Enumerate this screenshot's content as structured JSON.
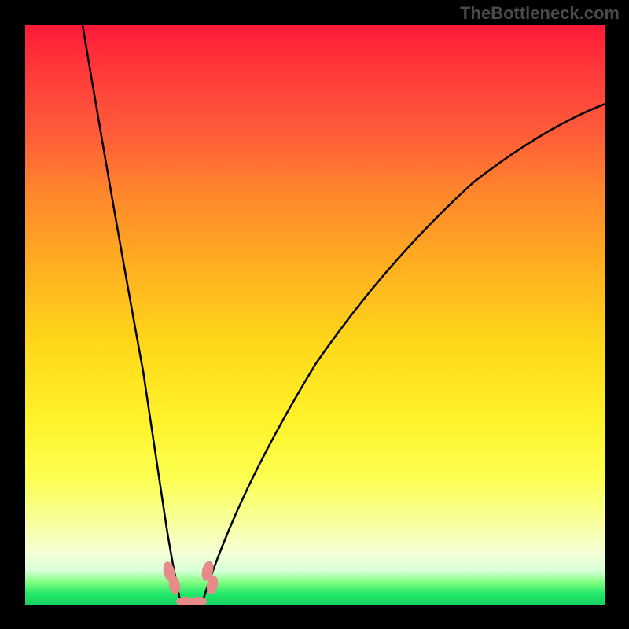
{
  "watermark": "TheBottleneck.com",
  "chart_data": {
    "type": "line",
    "title": "",
    "xlabel": "",
    "ylabel": "",
    "xlim": [
      0,
      100
    ],
    "ylim": [
      0,
      100
    ],
    "series": [
      {
        "name": "left-curve",
        "x": [
          10,
          12,
          15,
          18,
          20,
          22,
          24,
          25,
          26,
          27,
          28
        ],
        "y": [
          100,
          85,
          64,
          44,
          31,
          19,
          9,
          4,
          1,
          0,
          0
        ]
      },
      {
        "name": "right-curve",
        "x": [
          30,
          31,
          33,
          36,
          40,
          46,
          54,
          64,
          76,
          90,
          100
        ],
        "y": [
          0,
          0,
          2,
          6,
          13,
          24,
          38,
          53,
          67,
          79,
          86
        ]
      }
    ],
    "markers": [
      {
        "name": "marker-left",
        "x": 24.5,
        "y": 4
      },
      {
        "name": "marker-right",
        "x": 31.5,
        "y": 4
      },
      {
        "name": "marker-bottom",
        "x": 28,
        "y": 0
      }
    ],
    "gradient_stops": [
      {
        "pct": 0,
        "color": "#ff1a3a"
      },
      {
        "pct": 55,
        "color": "#ffd81a"
      },
      {
        "pct": 94,
        "color": "#d8ffd8"
      },
      {
        "pct": 100,
        "color": "#18d060"
      }
    ]
  }
}
